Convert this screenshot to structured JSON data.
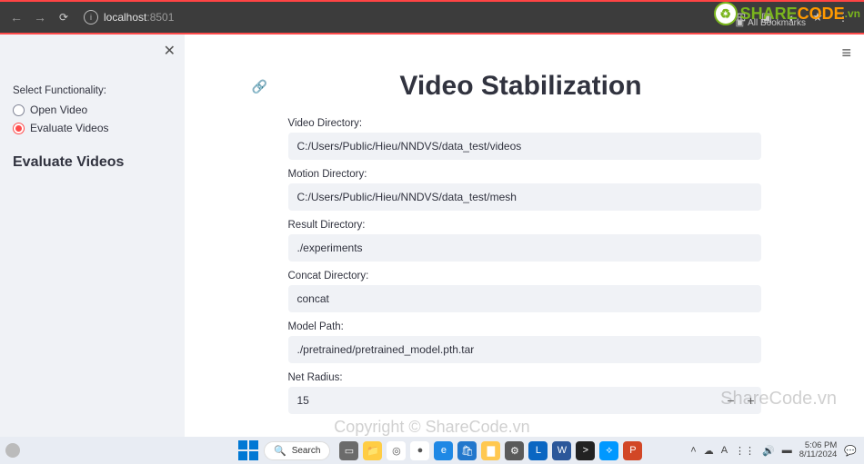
{
  "browser": {
    "url_host": "localhost",
    "url_port": ":8501",
    "bookmarks_label": "All Bookmarks"
  },
  "watermark": {
    "brand_a": "SHARE",
    "brand_b": "CODE",
    "brand_suffix": ".vn",
    "text1": "ShareCode.vn",
    "text2": "Copyright © ShareCode.vn"
  },
  "sidebar": {
    "header_label": "Select Functionality:",
    "options": [
      "Open Video",
      "Evaluate Videos"
    ],
    "selected_index": 1,
    "page_title": "Evaluate Videos"
  },
  "main": {
    "title": "Video Stabilization",
    "fields": [
      {
        "label": "Video Directory:",
        "value": "C:/Users/Public/Hieu/NNDVS/data_test/videos",
        "type": "text"
      },
      {
        "label": "Motion Directory:",
        "value": "C:/Users/Public/Hieu/NNDVS/data_test/mesh",
        "type": "text"
      },
      {
        "label": "Result Directory:",
        "value": "./experiments",
        "type": "text"
      },
      {
        "label": "Concat Directory:",
        "value": "concat",
        "type": "text"
      },
      {
        "label": "Model Path:",
        "value": "./pretrained/pretrained_model.pth.tar",
        "type": "text"
      },
      {
        "label": "Net Radius:",
        "value": "15",
        "type": "number"
      }
    ]
  },
  "taskbar": {
    "search_placeholder": "Search",
    "time": "5:06 PM",
    "date": "8/11/2024",
    "apps": [
      {
        "name": "task-view",
        "bg": "#6b6b6b",
        "glyph": "▭"
      },
      {
        "name": "explorer",
        "bg": "#ffcd44",
        "glyph": "📁"
      },
      {
        "name": "copilot",
        "bg": "#ffffff",
        "glyph": "◎"
      },
      {
        "name": "chrome",
        "bg": "#ffffff",
        "glyph": "●"
      },
      {
        "name": "edge",
        "bg": "#1e88e5",
        "glyph": "e"
      },
      {
        "name": "store",
        "bg": "#2277cc",
        "glyph": "🛍"
      },
      {
        "name": "folder",
        "bg": "#ffc850",
        "glyph": "▇"
      },
      {
        "name": "settings",
        "bg": "#5a5a5a",
        "glyph": "⚙"
      },
      {
        "name": "linkedin",
        "bg": "#0a66c2",
        "glyph": "L"
      },
      {
        "name": "word",
        "bg": "#2b579a",
        "glyph": "W"
      },
      {
        "name": "terminal",
        "bg": "#222",
        "glyph": ">"
      },
      {
        "name": "vscode",
        "bg": "#0098ff",
        "glyph": "⟡"
      },
      {
        "name": "powerpoint",
        "bg": "#d24726",
        "glyph": "P"
      }
    ]
  }
}
